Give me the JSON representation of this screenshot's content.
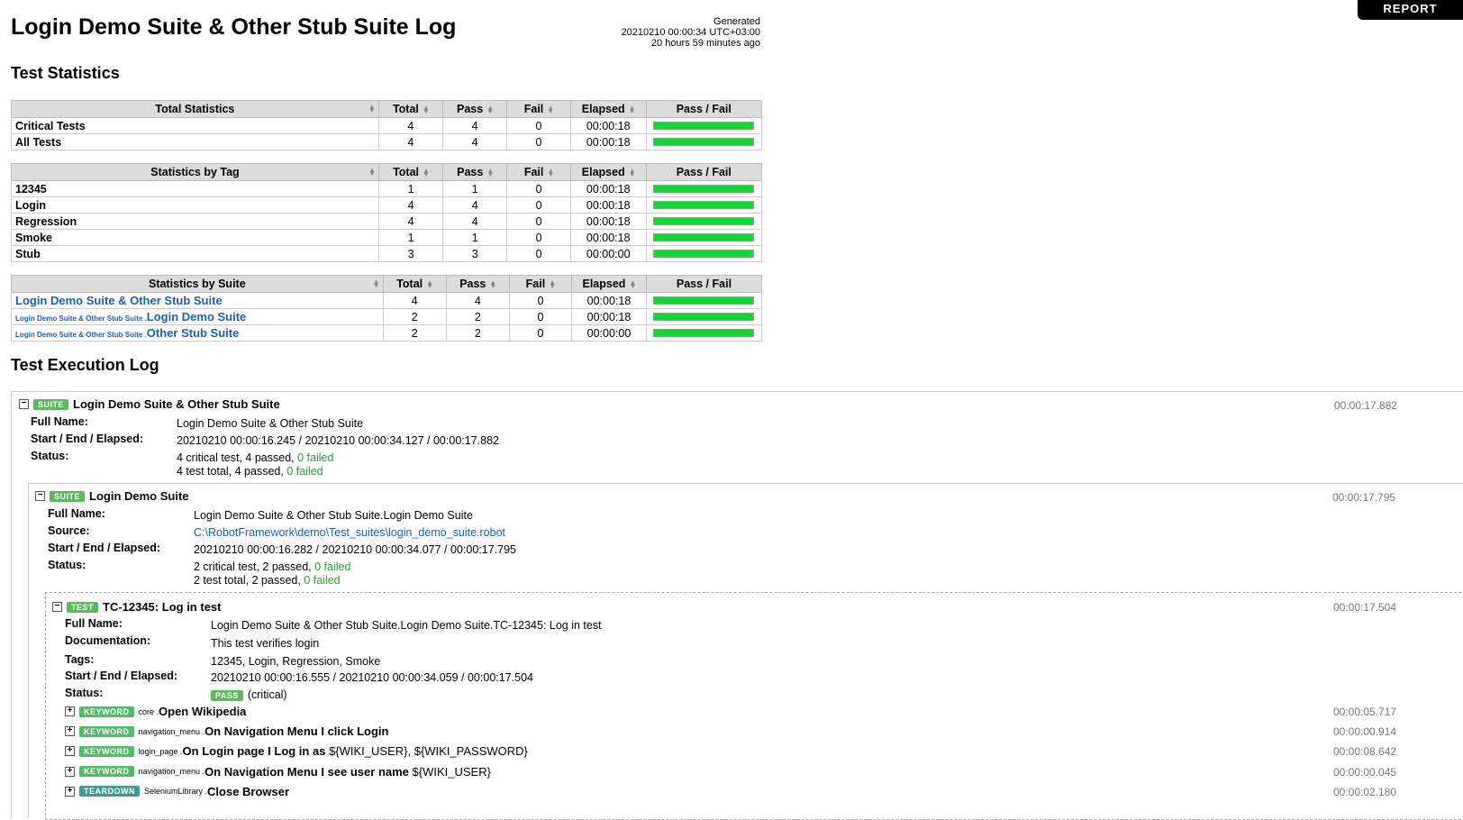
{
  "report_label": "REPORT",
  "title": "Login Demo Suite & Other Stub Suite Log",
  "generated": {
    "label": "Generated",
    "timestamp": "20210210 00:00:34 UTC+03:00",
    "ago": "20 hours 59 minutes ago"
  },
  "sections": {
    "stats": "Test Statistics",
    "log": "Test Execution Log"
  },
  "columns": {
    "total": "Total",
    "pass": "Pass",
    "fail": "Fail",
    "elapsed": "Elapsed",
    "passfail": "Pass / Fail"
  },
  "total_stats": {
    "header": "Total Statistics",
    "rows": [
      {
        "name": "Critical Tests",
        "total": "4",
        "pass": "4",
        "fail": "0",
        "elapsed": "00:00:18",
        "pass_ratio": 1.0
      },
      {
        "name": "All Tests",
        "total": "4",
        "pass": "4",
        "fail": "0",
        "elapsed": "00:00:18",
        "pass_ratio": 1.0
      }
    ]
  },
  "tag_stats": {
    "header": "Statistics by Tag",
    "rows": [
      {
        "name": "12345",
        "total": "1",
        "pass": "1",
        "fail": "0",
        "elapsed": "00:00:18",
        "pass_ratio": 1.0
      },
      {
        "name": "Login",
        "total": "4",
        "pass": "4",
        "fail": "0",
        "elapsed": "00:00:18",
        "pass_ratio": 1.0
      },
      {
        "name": "Regression",
        "total": "4",
        "pass": "4",
        "fail": "0",
        "elapsed": "00:00:18",
        "pass_ratio": 1.0
      },
      {
        "name": "Smoke",
        "total": "1",
        "pass": "1",
        "fail": "0",
        "elapsed": "00:00:18",
        "pass_ratio": 1.0
      },
      {
        "name": "Stub",
        "total": "3",
        "pass": "3",
        "fail": "0",
        "elapsed": "00:00:00",
        "pass_ratio": 1.0
      }
    ]
  },
  "suite_stats": {
    "header": "Statistics by Suite",
    "rows": [
      {
        "prefix": "",
        "name": "Login Demo Suite & Other Stub Suite",
        "total": "4",
        "pass": "4",
        "fail": "0",
        "elapsed": "00:00:18",
        "pass_ratio": 1.0
      },
      {
        "prefix": "Login Demo Suite & Other Stub Suite .",
        "name": "Login Demo Suite",
        "total": "2",
        "pass": "2",
        "fail": "0",
        "elapsed": "00:00:18",
        "pass_ratio": 1.0
      },
      {
        "prefix": "Login Demo Suite & Other Stub Suite .",
        "name": "Other Stub Suite",
        "total": "2",
        "pass": "2",
        "fail": "0",
        "elapsed": "00:00:00",
        "pass_ratio": 1.0
      }
    ]
  },
  "labels": {
    "full_name": "Full Name:",
    "start_end": "Start / End / Elapsed:",
    "status": "Status:",
    "source": "Source:",
    "documentation": "Documentation:",
    "tags": "Tags:"
  },
  "badges": {
    "suite": "SUITE",
    "test": "TEST",
    "keyword": "KEYWORD",
    "teardown": "TEARDOWN",
    "pass": "PASS"
  },
  "top_suite": {
    "name": "Login Demo Suite & Other Stub Suite",
    "elapsed": "00:00:17.882",
    "full_name": "Login Demo Suite & Other Stub Suite",
    "start_end": "20210210 00:00:16.245 / 20210210 00:00:34.127 / 00:00:17.882",
    "status_critical": "4 critical test, 4 passed,",
    "status_total": "4 test total, 4 passed,",
    "failed": "0 failed"
  },
  "sub_suite": {
    "name": "Login Demo Suite",
    "elapsed": "00:00:17.795",
    "full_name": "Login Demo Suite & Other Stub Suite.Login Demo Suite",
    "source": "C:\\RobotFramework\\demo\\Test_suites\\login_demo_suite.robot",
    "start_end": "20210210 00:00:16.282 / 20210210 00:00:34.077 / 00:00:17.795",
    "status_critical": "2 critical test, 2 passed,",
    "status_total": "2 test total, 2 passed,",
    "failed": "0 failed"
  },
  "test": {
    "name": "TC-12345: Log in test",
    "elapsed": "00:00:17.504",
    "full_name": "Login Demo Suite & Other Stub Suite.Login Demo Suite.TC-12345: Log in test",
    "documentation": "This test verifies login",
    "tags": "12345, Login, Regression, Smoke",
    "start_end": "20210210 00:00:16.555 / 20210210 00:00:34.059 / 00:00:17.504",
    "status_suffix": "(critical)"
  },
  "keywords": [
    {
      "type": "keyword",
      "lib": "core .",
      "name": "Open Wikipedia",
      "args": "",
      "elapsed": "00:00:05.717"
    },
    {
      "type": "keyword",
      "lib": "navigation_menu .",
      "name": "On Navigation Menu I click Login",
      "args": "",
      "elapsed": "00:00:00.914"
    },
    {
      "type": "keyword",
      "lib": "login_page .",
      "name": "On Login page I Log in as",
      "args": "${WIKI_USER}, ${WIKI_PASSWORD}",
      "elapsed": "00:00:08.642"
    },
    {
      "type": "keyword",
      "lib": "navigation_menu .",
      "name": "On Navigation Menu I see user name",
      "args": "${WIKI_USER}",
      "elapsed": "00:00:00.045"
    },
    {
      "type": "teardown",
      "lib": "SeleniumLibrary .",
      "name": "Close Browser",
      "args": "",
      "elapsed": "00:00:02.180"
    }
  ]
}
